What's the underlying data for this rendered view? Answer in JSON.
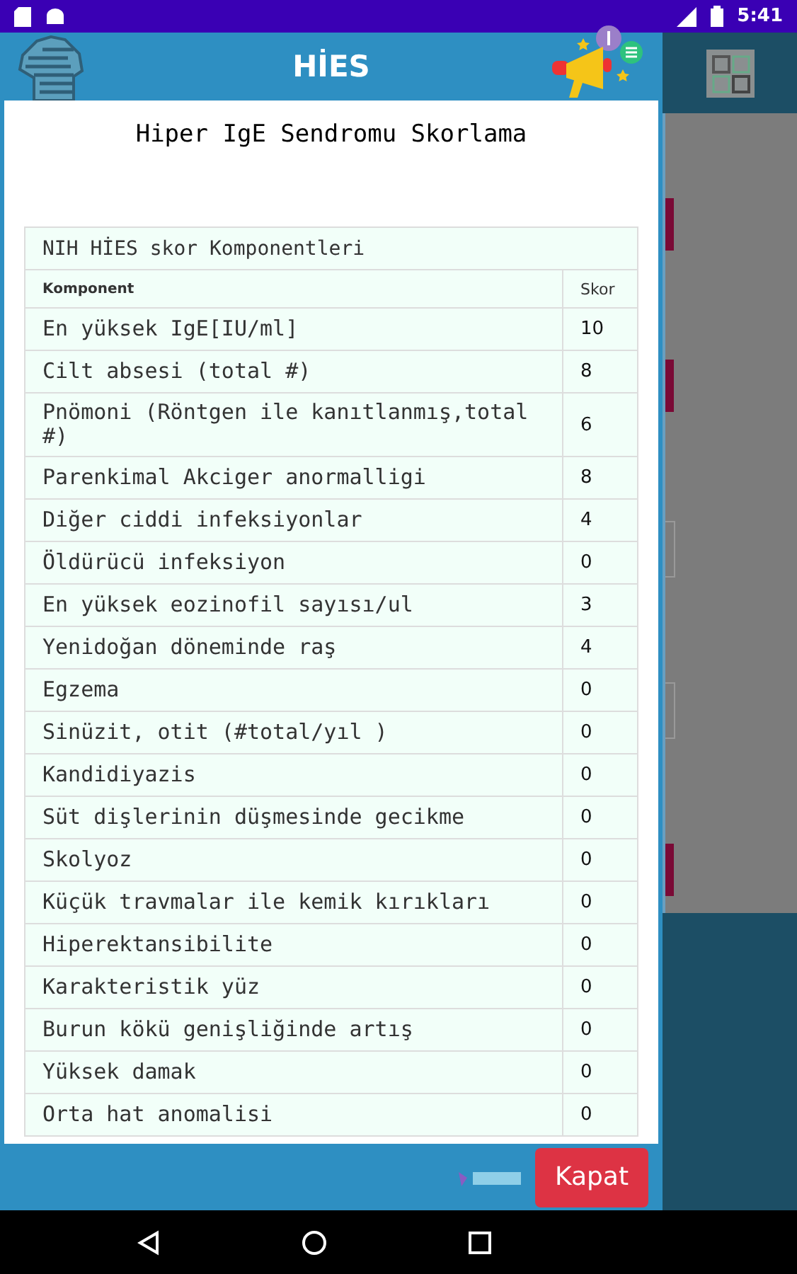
{
  "status_bar": {
    "time": "5:41"
  },
  "header": {
    "title": "HİES"
  },
  "dialog": {
    "title": "Hiper IgE Sendromu Skorlama",
    "table": {
      "caption": "NIH HİES skor Komponentleri",
      "columns": [
        "Komponent",
        "Skor"
      ],
      "rows": [
        {
          "component": "En yüksek IgE[IU/ml]",
          "score": "10"
        },
        {
          "component": "Cilt absesi (total #)",
          "score": "8"
        },
        {
          "component": "Pnömoni (Röntgen ile kanıtlanmış,total #)",
          "score": "6"
        },
        {
          "component": "Parenkimal Akciger anormalligi",
          "score": "8"
        },
        {
          "component": "Diğer ciddi infeksiyonlar",
          "score": "4"
        },
        {
          "component": "Öldürücü infeksiyon",
          "score": "0"
        },
        {
          "component": "En yüksek eozinofil sayısı/ul",
          "score": "3"
        },
        {
          "component": "Yenidoğan döneminde raş",
          "score": "4"
        },
        {
          "component": "Egzema",
          "score": "0"
        },
        {
          "component": "Sinüzit, otit (#total/yıl )",
          "score": "0"
        },
        {
          "component": "Kandidiyazis",
          "score": "0"
        },
        {
          "component": "Süt dişlerinin düşmesinde gecikme",
          "score": "0"
        },
        {
          "component": "Skolyoz",
          "score": "0"
        },
        {
          "component": "Küçük travmalar ile kemik kırıkları",
          "score": "0"
        },
        {
          "component": "Hiperektansibilite",
          "score": "0"
        },
        {
          "component": "Karakteristik yüz",
          "score": "0"
        },
        {
          "component": "Burun kökü genişliğinde artış",
          "score": "0"
        },
        {
          "component": "Yüksek damak",
          "score": "0"
        },
        {
          "component": "Orta hat anomalisi",
          "score": "0"
        }
      ]
    }
  },
  "footer": {
    "button": "Kapat"
  }
}
